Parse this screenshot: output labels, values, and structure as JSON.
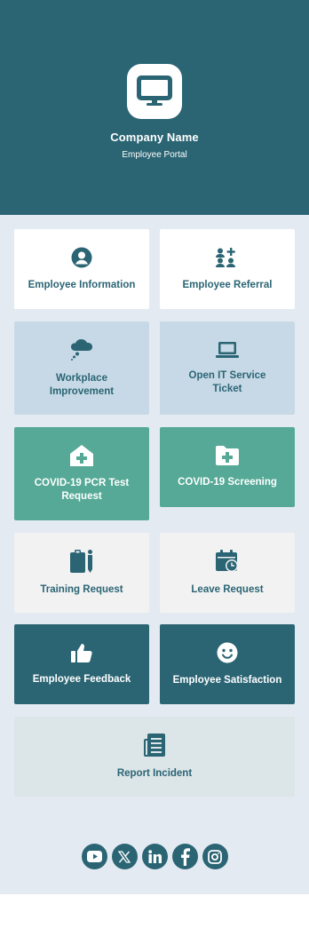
{
  "colors": {
    "primary": "#2b6574",
    "page_bg": "#e4eaf2",
    "green": "#55a996",
    "blue_tile": "#c7d9e6",
    "light_tile": "#f2f2f2",
    "pale_tile": "#dce5e8"
  },
  "header": {
    "company_name": "Company Name",
    "subtitle": "Employee Portal",
    "logo_icon": "monitor-icon"
  },
  "tiles": [
    {
      "label": "Employee Information",
      "icon": "user-circle-icon"
    },
    {
      "label": "Employee Referral",
      "icon": "users-plus-icon"
    },
    {
      "label": "Workplace Improvement",
      "icon": "thought-cloud-icon"
    },
    {
      "label": "Open IT Service Ticket",
      "icon": "laptop-icon"
    },
    {
      "label": "COVID-19 PCR Test Request",
      "icon": "medical-house-icon"
    },
    {
      "label": "COVID-19 Screening",
      "icon": "medical-folder-icon"
    },
    {
      "label": "Training Request",
      "icon": "clipboard-pen-icon"
    },
    {
      "label": "Leave Request",
      "icon": "calendar-clock-icon"
    },
    {
      "label": "Employee Feedback",
      "icon": "thumbs-up-icon"
    },
    {
      "label": "Employee Satisfaction",
      "icon": "smiley-icon"
    },
    {
      "label": "Report Incident",
      "icon": "newspaper-icon"
    }
  ],
  "social": [
    "youtube-icon",
    "x-icon",
    "linkedin-icon",
    "facebook-icon",
    "instagram-icon"
  ]
}
